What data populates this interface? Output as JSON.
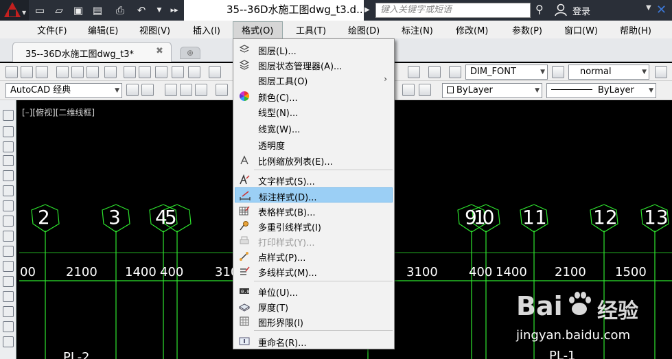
{
  "titlebar": {
    "doc_title": "35--36D水施工图dwg_t3.d...",
    "search_placeholder": "键入关键字或短语",
    "login": "登录"
  },
  "menubar": {
    "items": [
      "文件(F)",
      "编辑(E)",
      "视图(V)",
      "插入(I)",
      "格式(O)",
      "工具(T)",
      "绘图(D)",
      "标注(N)",
      "修改(M)",
      "参数(P)",
      "窗口(W)",
      "帮助(H)"
    ]
  },
  "tabs": {
    "active": "35--36D水施工图dwg_t3*"
  },
  "toolbar": {
    "workspace": "AutoCAD 经典",
    "text_style": "DIM_FONT",
    "dim_style": "normal",
    "color": "ByLayer",
    "linetype": "ByLayer"
  },
  "drawing": {
    "viewport_label": "[–][俯视][二维线框]",
    "axis_labels": [
      "2",
      "3",
      "45",
      "910",
      "11",
      "12",
      "13"
    ],
    "dimension_values": [
      "00",
      "2100",
      "1400",
      "400",
      "310",
      "3100",
      "400",
      "1400",
      "2100",
      "1500"
    ],
    "bottom_labels": [
      "PL-2",
      "PL-1"
    ]
  },
  "format_menu": {
    "items": [
      {
        "label": "图层(L)...",
        "icon": "layer-icon"
      },
      {
        "label": "图层状态管理器(A)...",
        "icon": "layer-state-icon"
      },
      {
        "label": "图层工具(O)",
        "icon": "",
        "submenu": "›"
      },
      {
        "label": "颜色(C)...",
        "icon": "color-wheel-icon"
      },
      {
        "label": "线型(N)...",
        "icon": ""
      },
      {
        "label": "线宽(W)...",
        "icon": ""
      },
      {
        "label": "透明度",
        "icon": ""
      },
      {
        "label": "比例缩放列表(E)...",
        "icon": "scale-list-icon"
      },
      {
        "label": "文字样式(S)...",
        "icon": "text-style-icon"
      },
      {
        "label": "标注样式(D)...",
        "icon": "dim-style-icon"
      },
      {
        "label": "表格样式(B)...",
        "icon": "table-style-icon"
      },
      {
        "label": "多重引线样式(I)",
        "icon": "mleader-style-icon"
      },
      {
        "label": "打印样式(Y)...",
        "icon": "print-style-icon"
      },
      {
        "label": "点样式(P)...",
        "icon": "point-style-icon"
      },
      {
        "label": "多线样式(M)...",
        "icon": "mline-style-icon"
      },
      {
        "label": "单位(U)...",
        "icon": "units-icon"
      },
      {
        "label": "厚度(T)",
        "icon": "thickness-icon"
      },
      {
        "label": "图形界限(I)",
        "icon": "limits-icon"
      },
      {
        "label": "重命名(R)...",
        "icon": "rename-icon"
      }
    ]
  },
  "watermark": {
    "brand": "Bai",
    "brand_suffix": "经验",
    "url": "jingyan.baidu.com"
  },
  "colors": {
    "drawing_bg": "#000000",
    "axis_line": "#2ee62e",
    "menu_highlight": "#9bcff5",
    "autocad_red": "#c3201f"
  }
}
